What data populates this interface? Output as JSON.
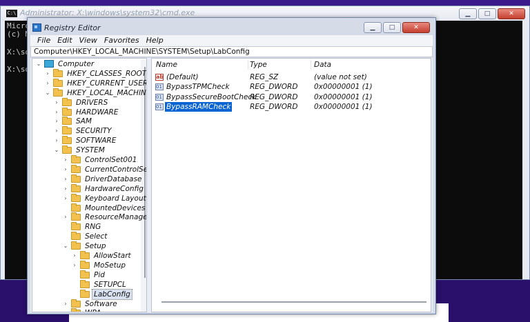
{
  "cmd": {
    "title": "Administrator: X:\\windows\\system32\\cmd.exe",
    "icon": "cmd-icon",
    "lines": [
      "Micro",
      "(c) M",
      "",
      "X:\\so",
      "",
      "X:\\so"
    ],
    "buttons": {
      "minimize": "▁",
      "maximize": "□",
      "close": "✕"
    }
  },
  "regedit": {
    "title": "Registry Editor",
    "icon": "registry-editor-icon",
    "buttons": {
      "minimize": "▁",
      "maximize": "□",
      "close": "✕"
    },
    "menu": [
      "File",
      "Edit",
      "View",
      "Favorites",
      "Help"
    ],
    "address": "Computer\\HKEY_LOCAL_MACHINE\\SYSTEM\\Setup\\LabConfig",
    "tree": [
      {
        "label": "Computer",
        "chevron": "⌄",
        "icon": "computer-icon"
      },
      {
        "label": "HKEY_CLASSES_ROOT",
        "chevron": "›",
        "icon": "folder-icon"
      },
      {
        "label": "HKEY_CURRENT_USER",
        "chevron": "›",
        "icon": "folder-icon"
      },
      {
        "label": "HKEY_LOCAL_MACHINE",
        "chevron": "⌄",
        "icon": "folder-icon"
      },
      {
        "label": "DRIVERS",
        "chevron": "›",
        "icon": "folder-icon"
      },
      {
        "label": "HARDWARE",
        "chevron": "›",
        "icon": "folder-icon"
      },
      {
        "label": "SAM",
        "chevron": "›",
        "icon": "folder-icon"
      },
      {
        "label": "SECURITY",
        "chevron": "›",
        "icon": "folder-icon"
      },
      {
        "label": "SOFTWARE",
        "chevron": "›",
        "icon": "folder-icon"
      },
      {
        "label": "SYSTEM",
        "chevron": "⌄",
        "icon": "folder-icon"
      },
      {
        "label": "ControlSet001",
        "chevron": "›",
        "icon": "folder-icon"
      },
      {
        "label": "CurrentControlSet",
        "chevron": "›",
        "icon": "folder-icon"
      },
      {
        "label": "DriverDatabase",
        "chevron": "›",
        "icon": "folder-icon"
      },
      {
        "label": "HardwareConfig",
        "chevron": "›",
        "icon": "folder-icon"
      },
      {
        "label": "Keyboard Layout",
        "chevron": "›",
        "icon": "folder-icon"
      },
      {
        "label": "MountedDevices",
        "chevron": "",
        "icon": "folder-icon"
      },
      {
        "label": "ResourceManager",
        "chevron": "›",
        "icon": "folder-icon"
      },
      {
        "label": "RNG",
        "chevron": "",
        "icon": "folder-icon"
      },
      {
        "label": "Select",
        "chevron": "",
        "icon": "folder-icon"
      },
      {
        "label": "Setup",
        "chevron": "⌄",
        "icon": "folder-icon"
      },
      {
        "label": "AllowStart",
        "chevron": "›",
        "icon": "folder-icon"
      },
      {
        "label": "MoSetup",
        "chevron": "›",
        "icon": "folder-icon"
      },
      {
        "label": "Pid",
        "chevron": "",
        "icon": "folder-icon"
      },
      {
        "label": "SETUPCL",
        "chevron": "",
        "icon": "folder-icon"
      },
      {
        "label": "LabConfig",
        "chevron": "",
        "icon": "folder-icon",
        "selected": true
      },
      {
        "label": "Software",
        "chevron": "›",
        "icon": "folder-icon"
      },
      {
        "label": "WPA",
        "chevron": "›",
        "icon": "folder-icon"
      }
    ],
    "columns": [
      "Name",
      "Type",
      "Data"
    ],
    "values": [
      {
        "name": "(Default)",
        "type": "REG_SZ",
        "data": "(value not set)",
        "icon": "string-value-icon"
      },
      {
        "name": "BypassTPMCheck",
        "type": "REG_DWORD",
        "data": "0x00000001 (1)",
        "icon": "dword-value-icon"
      },
      {
        "name": "BypassSecureBootCheck",
        "type": "REG_DWORD",
        "data": "0x00000001 (1)",
        "icon": "dword-value-icon"
      },
      {
        "name": "BypassRAMCheck",
        "type": "REG_DWORD",
        "data": "0x00000001 (1)",
        "icon": "dword-value-icon",
        "selected": true
      }
    ]
  },
  "colors": {
    "desktop": "#2a0f6b",
    "selection": "#0a64d2",
    "close_button": "#c4402f"
  }
}
